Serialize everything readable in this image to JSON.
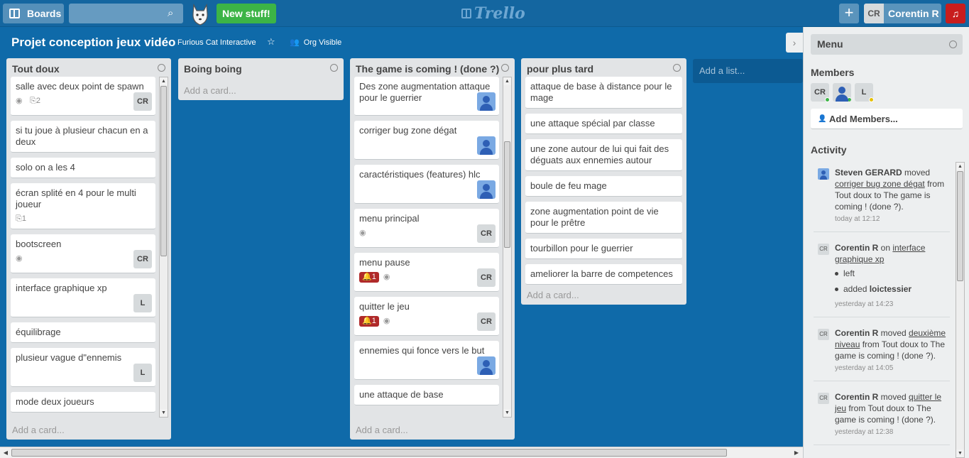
{
  "header": {
    "boards_label": "Boards",
    "search_placeholder": "",
    "new_stuff_label": "New stuff!",
    "logo_text": "Trello",
    "add_button": "+",
    "user_initials": "CR",
    "user_name": "Corentin R"
  },
  "board": {
    "title": "Projet conception jeux vidéo",
    "org": "Furious Cat Interactive",
    "visibility": "Org Visible"
  },
  "lists": [
    {
      "name": "Tout doux",
      "add_card": "Add a card...",
      "cards": [
        {
          "title": "salle avec deux point de spawn",
          "watch": true,
          "attachments": "2",
          "member": "CR"
        },
        {
          "title": "si tu joue à plusieur chacun en a deux"
        },
        {
          "title": "solo on a les 4"
        },
        {
          "title": "écran splité en 4 pour le multi joueur",
          "attachments": "1"
        },
        {
          "title": "bootscreen",
          "watch": true,
          "member": "CR"
        },
        {
          "title": "interface graphique xp",
          "member": "L"
        },
        {
          "title": "équilibrage"
        },
        {
          "title": "plusieur vague d\"ennemis",
          "member": "L"
        },
        {
          "title": "mode deux joueurs"
        }
      ]
    },
    {
      "name": "Boing boing",
      "add_card": "Add a card...",
      "cards": []
    },
    {
      "name": "The game is coming ! (done ?)",
      "add_card": "Add a card...",
      "cards": [
        {
          "title": "Des zone augmentation attaque pour le guerrier",
          "member_photo": true
        },
        {
          "title": "corriger bug zone dégat",
          "member_photo": true
        },
        {
          "title": "caractéristiques (features) hlc",
          "member_photo": true
        },
        {
          "title": "menu principal",
          "watch": true,
          "member": "CR"
        },
        {
          "title": "menu pause",
          "alert": "1",
          "watch": true,
          "member": "CR"
        },
        {
          "title": "quitter le jeu",
          "alert": "1",
          "watch": true,
          "member": "CR"
        },
        {
          "title": "ennemies qui fonce vers le but",
          "member_photo": true
        },
        {
          "title": "une attaque de base"
        }
      ]
    },
    {
      "name": "pour plus tard",
      "add_card": "Add a card...",
      "cards": [
        {
          "title": "attaque de base à distance pour le mage"
        },
        {
          "title": "une attaque spécial par classe"
        },
        {
          "title": "une zone autour de lui qui fait des déguats aux ennemies autour"
        },
        {
          "title": "boule de feu mage"
        },
        {
          "title": "zone augmentation point de vie pour le prêtre"
        },
        {
          "title": "tourbillon pour le guerrier"
        },
        {
          "title": "ameliorer la barre de competences"
        }
      ]
    }
  ],
  "add_list": "Add a list...",
  "menu": {
    "title": "Menu",
    "members_label": "Members",
    "members": [
      "CR",
      "",
      "L"
    ],
    "add_members": "Add Members...",
    "activity_label": "Activity",
    "activity": [
      {
        "who": "Steven GERARD",
        "text1": " moved ",
        "link": "corriger bug zone dégat",
        "text2": " from Tout doux to The game is coming ! (done ?).",
        "time": "today at 12:12",
        "avatar": ""
      },
      {
        "who": "Corentin R",
        "text1": " on ",
        "link": "interface graphique xp",
        "text2": "",
        "items": [
          "left",
          "added loictessier"
        ],
        "time": "yesterday at 14:23",
        "avatar": "CR"
      },
      {
        "who": "Corentin R",
        "text1": " moved ",
        "link": "deuxième niveau",
        "text2": " from Tout doux to The game is coming ! (done ?).",
        "time": "yesterday at 14:05",
        "avatar": "CR"
      },
      {
        "who": "Corentin R",
        "text1": " moved ",
        "link": "quitter le jeu",
        "text2": " from Tout doux to The game is coming ! (done ?).",
        "time": "yesterday at 12:38",
        "avatar": "CR"
      }
    ]
  },
  "colors": {
    "board_bg": "#0f6aa9",
    "header_bg": "#1466a0",
    "new_stuff": "#3cb446",
    "alert": "#c81d1d"
  }
}
